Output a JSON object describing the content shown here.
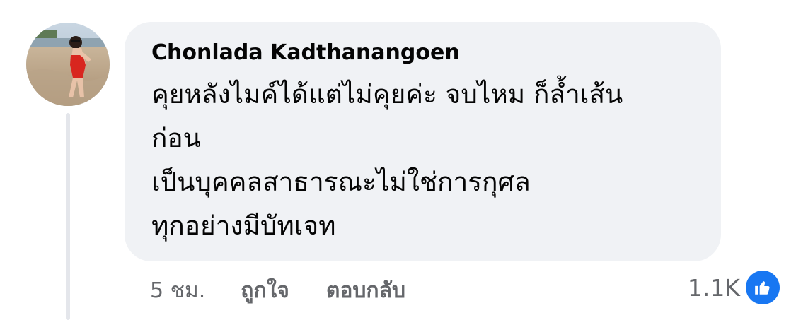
{
  "comment": {
    "author": "Chonlada Kadthanangoen",
    "text": "คุยหลังไมค์ได้แต่ไม่คุยค่ะ จบไหม ก็ล้ำเส้น\nก่อน\nเป็นบุคคลสาธารณะไม่ใช่การกุศล\nทุกอย่างมีบัทเจท",
    "timestamp": "5 ชม.",
    "like_label": "ถูกใจ",
    "reply_label": "ตอบกลับ",
    "reaction_count": "1.1K",
    "reaction_icon": "thumbs-up-icon",
    "avatar_icon": "profile-photo"
  },
  "colors": {
    "bubble": "#f0f2f5",
    "text": "#050505",
    "secondary": "#65676b",
    "like_badge": "#1877f2",
    "thread_line": "#e4e6eb"
  }
}
